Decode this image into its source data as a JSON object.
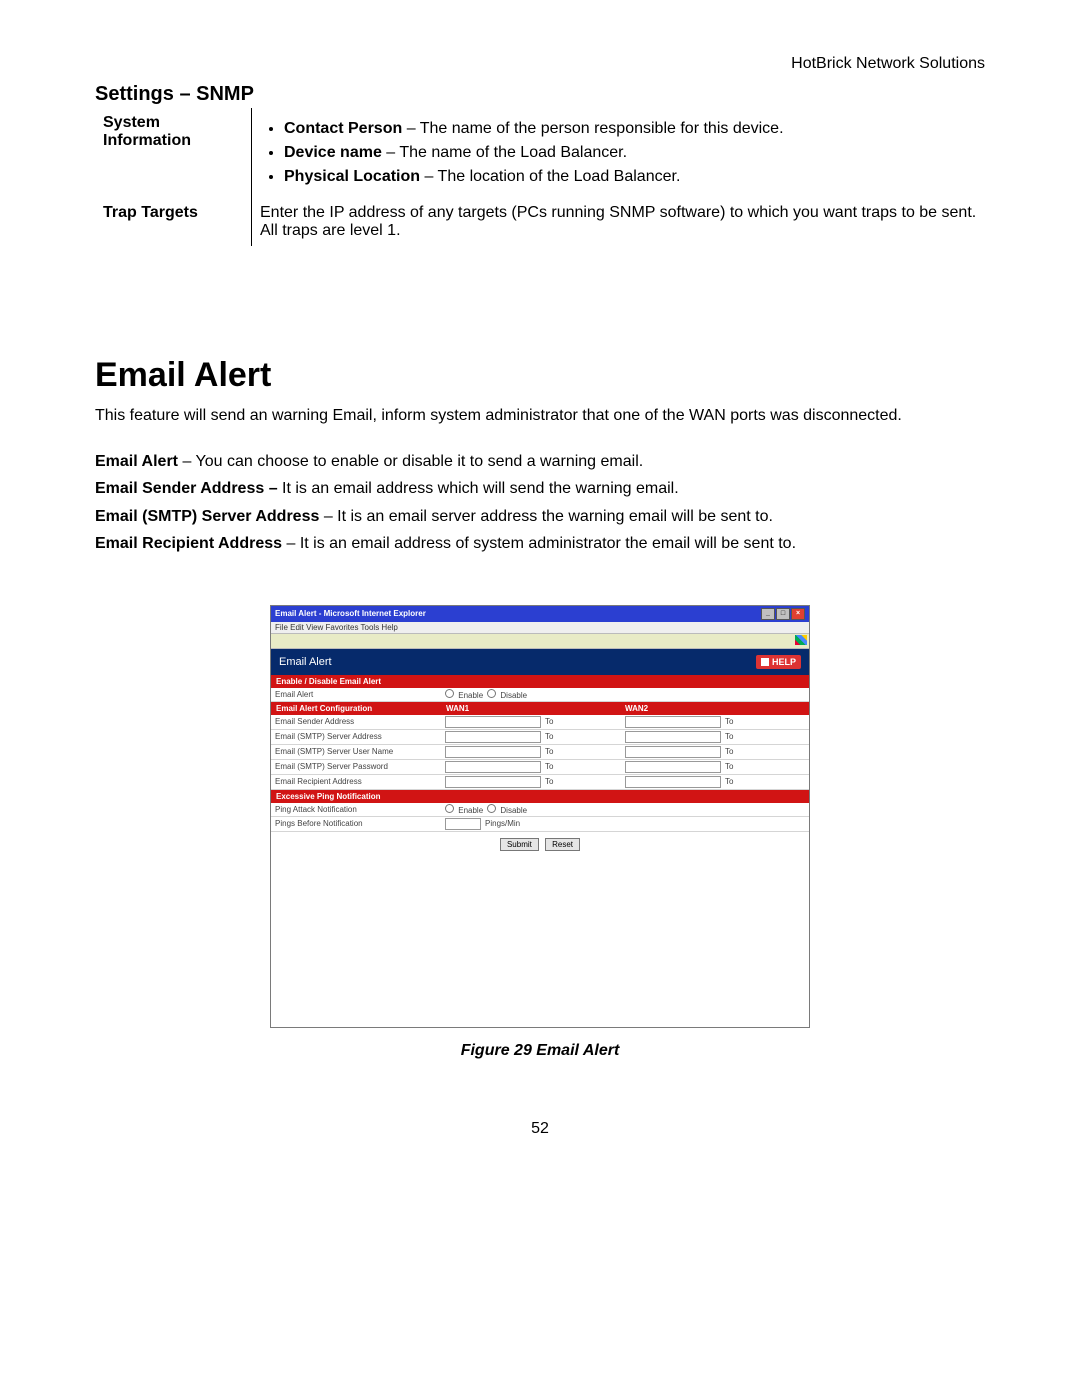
{
  "header": {
    "company": "HotBrick Network Solutions"
  },
  "settings_snmp": {
    "title": "Settings – SNMP",
    "rows": [
      {
        "label": "System Information",
        "bullets": [
          {
            "term": "Contact Person",
            "desc": " – The name of the person responsible for this device."
          },
          {
            "term": "Device name",
            "desc": " – The name of the Load Balancer."
          },
          {
            "term": "Physical Location",
            "desc": " – The location of the Load Balancer."
          }
        ]
      },
      {
        "label": "Trap Targets",
        "text": "Enter the IP address of any targets (PCs running SNMP software) to which you want traps to be sent. All traps are level 1."
      }
    ]
  },
  "email_alert": {
    "heading": "Email Alert",
    "intro": "This feature will send an warning Email, inform system administrator that one of the WAN ports was disconnected.",
    "defs": [
      {
        "term": "Email Alert",
        "desc": " – You can choose to enable or disable it to send a warning email."
      },
      {
        "term": "Email  Sender Address –",
        "desc": " It is an email address which will send the warning email."
      },
      {
        "term": "Email (SMTP) Server Address",
        "desc": " – It is an email server address the warning email will be sent to."
      },
      {
        "term": "Email Recipient Address",
        "desc": " – It is an email address of system administrator the email will be sent to."
      }
    ]
  },
  "screenshot": {
    "window_title": "Email Alert - Microsoft Internet Explorer",
    "menubar": "File   Edit   View   Favorites   Tools   Help",
    "panel_title": "Email Alert",
    "help_label": "HELP",
    "sections": {
      "enable_header": "Enable / Disable Email Alert",
      "enable_row_label": "Email Alert",
      "enable_opt1": "Enable",
      "enable_opt2": "Disable",
      "config_header": "Email Alert Configuration",
      "wan1": "WAN1",
      "wan2": "WAN2",
      "rows": [
        "Email Sender Address",
        "Email (SMTP) Server Address",
        "Email (SMTP) Server User Name",
        "Email (SMTP) Server Password",
        "Email Recipient Address"
      ],
      "to": "To",
      "ping_header": "Excessive Ping Notification",
      "ping_row1_label": "Ping Attack Notification",
      "ping_row2_label": "Pings Before Notification",
      "ping_row2_unit": "Pings/Min",
      "submit": "Submit",
      "reset": "Reset"
    }
  },
  "caption": "Figure 29 Email Alert",
  "page_number": "52"
}
